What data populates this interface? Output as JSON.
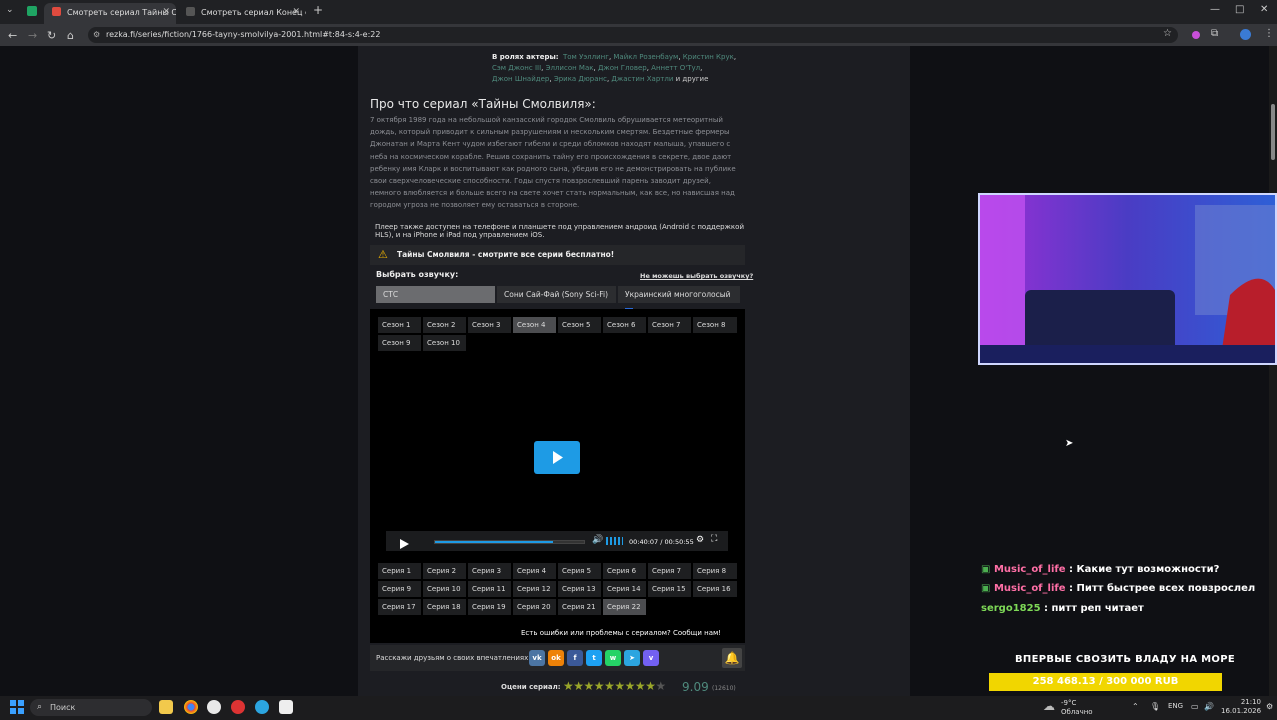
{
  "browser": {
    "tabs": [
      {
        "title": "Смотреть сериал Тайны Смолв",
        "active": true
      },
      {
        "title": "Смотреть сериал Конец е***",
        "active": false
      }
    ],
    "new_tab": "+",
    "url": "rezka.fi/series/fiction/1766-tayny-smolvilya-2001.html#t:84-s:4-e:22",
    "window_controls": {
      "minimize": "—",
      "maximize": "□",
      "close": "✕"
    }
  },
  "cast": {
    "label": "В ролях актеры:",
    "line1": [
      "Том Уэллинг",
      "Майкл Розенбаум",
      "Кристин Крук"
    ],
    "line2": [
      "Сэм Джонс III",
      "Эллисон Мак",
      "Джон Гловер",
      "Аннетт О'Тул"
    ],
    "line3": [
      "Джон Шнайдер",
      "Эрика Дюранс",
      "Джастин Хартли"
    ],
    "others": "и другие"
  },
  "about": {
    "title": "Про что сериал «Тайны Смолвиля»:",
    "text": "7 октября 1989 года на небольшой канзасский городок Смолвиль обрушивается метеоритный дождь, который приводит к сильным разрушениям и нескольким смертям. Бездетные фермеры Джонатан и Марта Кент чудом избегают гибели и среди обломков находят малыша, упавшего с неба на космическом корабле. Решив сохранить тайну его происхождения в секрете, двое дают ребенку имя Кларк и воспитывают как родного сына, убедив его не демонстрировать на публике свои сверхчеловеческие способности. Годы спустя повзрослевший парень заводит друзей, немного влюбляется и больше всего на свете хочет стать нормальным, как все, но нависшая над городом угроза не позволяет ему оставаться в стороне."
  },
  "player_notice": "Плеер также доступен на телефоне и планшете под управлением андроид (Android с поддержкой HLS), и на iPhone и iPad под управлением iOS.",
  "free_banner": "Тайны Смолвиля - смотрите все серии бесплатно!",
  "dub": {
    "label": "Выбрать озвучку:",
    "cant_choose": "Не можешь выбрать озвучку?",
    "options": [
      "СТС",
      "Сони Сай-Фай (Sony Sci-Fi)",
      "Украинский многоголосый"
    ],
    "selected": "СТС"
  },
  "seasons": {
    "items": [
      "Сезон 1",
      "Сезон 2",
      "Сезон 3",
      "Сезон 4",
      "Сезон 5",
      "Сезон 6",
      "Сезон 7",
      "Сезон 8",
      "Сезон 9",
      "Сезон 10"
    ],
    "active": "Сезон 4"
  },
  "player": {
    "time_current": "00:40:07",
    "time_total": "00:50:55",
    "time_display": "00:40:07 / 00:50:55",
    "progress": 0.79,
    "volume_level": 1.0
  },
  "episodes": {
    "items": [
      "Серия 1",
      "Серия 2",
      "Серия 3",
      "Серия 4",
      "Серия 5",
      "Серия 6",
      "Серия 7",
      "Серия 8",
      "Серия 9",
      "Серия 10",
      "Серия 11",
      "Серия 12",
      "Серия 13",
      "Серия 14",
      "Серия 15",
      "Серия 16",
      "Серия 17",
      "Серия 18",
      "Серия 19",
      "Серия 20",
      "Серия 21",
      "Серия 22"
    ],
    "active": "Серия 22"
  },
  "report": "Есть ошибки или проблемы с сериалом? Сообщи нам!",
  "share": {
    "label": "Расскажи друзьям о своих впечатлениях:",
    "icons": [
      "vk-icon",
      "ok-icon",
      "facebook-icon",
      "twitter-icon",
      "whatsapp-icon",
      "telegram-icon",
      "viber-icon"
    ]
  },
  "rating": {
    "label": "Оцени сериал:",
    "value": "9.09",
    "votes": "(12610)",
    "stars": 10
  },
  "chat": [
    {
      "user": "Music_of_life",
      "text": ": Какие тут возможности?"
    },
    {
      "user": "Music_of_life",
      "text": ": Питт быстрее всех повзрослел"
    },
    {
      "user": "sergo1825",
      "text": ": питт реп читает"
    }
  ],
  "donation": {
    "title": "ВПЕРВЫЕ СВОЗИТЬ ВЛАДУ НА МОРЕ",
    "amount": "258 468.13 / 300 000 RUB",
    "progress": 0.8616
  },
  "taskbar": {
    "search_placeholder": "Поиск",
    "weather_temp": "-9°C",
    "weather_desc": "Облачно",
    "lang": "ENG",
    "time": "21:10",
    "date": "16.01.2026"
  },
  "colors": {
    "accent_blue": "#1e9be5",
    "link": "#4f8a7d",
    "donation_bar": "#f1d600",
    "chat_name": "#ff6fa6",
    "chat_name_alt": "#7ed957"
  }
}
